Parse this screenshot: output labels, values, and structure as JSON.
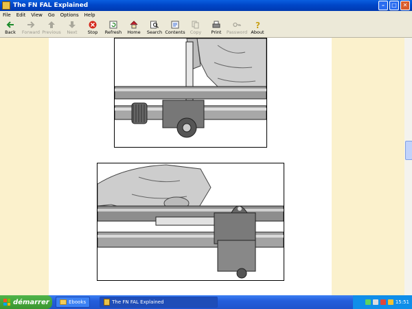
{
  "window": {
    "title": "The FN FAL Explained"
  },
  "menu": [
    "File",
    "Edit",
    "View",
    "Go",
    "Options",
    "Help"
  ],
  "toolbar": [
    {
      "label": "Back",
      "icon": "back-arrow-icon",
      "enabled": true
    },
    {
      "label": "Forward",
      "icon": "forward-arrow-icon",
      "enabled": false
    },
    {
      "label": "Previous",
      "icon": "previous-icon",
      "enabled": false
    },
    {
      "label": "Next",
      "icon": "next-icon",
      "enabled": false
    },
    {
      "label": "Stop",
      "icon": "stop-icon",
      "enabled": true
    },
    {
      "label": "Refresh",
      "icon": "refresh-icon",
      "enabled": true
    },
    {
      "label": "Home",
      "icon": "home-icon",
      "enabled": true
    },
    {
      "label": "Search",
      "icon": "search-icon",
      "enabled": true
    },
    {
      "label": "Contents",
      "icon": "contents-icon",
      "enabled": true
    },
    {
      "label": "Copy",
      "icon": "copy-icon",
      "enabled": false
    },
    {
      "label": "Print",
      "icon": "print-icon",
      "enabled": true
    },
    {
      "label": "Password",
      "icon": "password-key-icon",
      "enabled": false
    },
    {
      "label": "About",
      "icon": "about-icon",
      "enabled": true
    }
  ],
  "taskbar": {
    "start_label": "démarrer",
    "tasks": [
      {
        "label": "Ebooks",
        "active": false
      },
      {
        "label": "The FN FAL Explained",
        "active": true
      }
    ],
    "language": "FR",
    "clock": "15:51"
  },
  "colors": {
    "title_bar": "#0046c8",
    "page_margin": "#fbf1cc",
    "taskbar": "#245edc",
    "start_button": "#3a962f"
  }
}
